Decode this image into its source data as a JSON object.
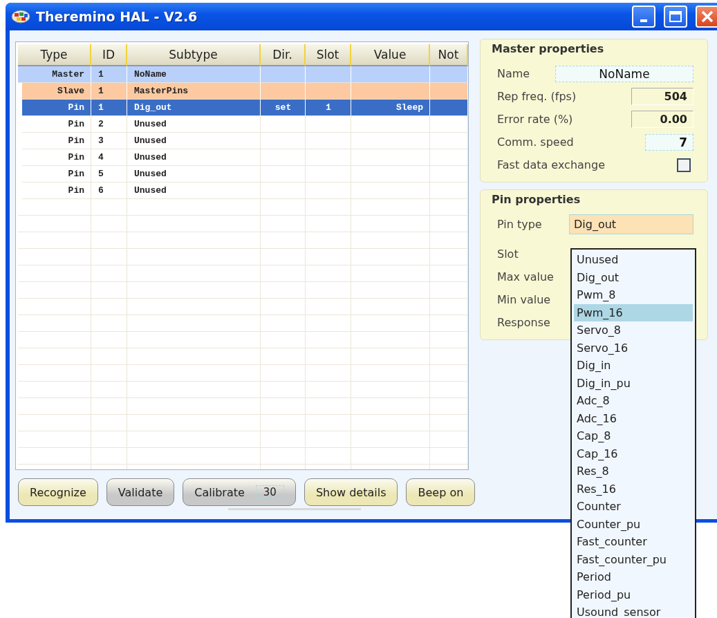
{
  "window": {
    "title": "Theremino HAL - V2.6"
  },
  "table": {
    "columns": [
      "Type",
      "ID",
      "Subtype",
      "Dir.",
      "Slot",
      "Value",
      "Not"
    ],
    "rows": [
      {
        "kind": "master",
        "selected": false,
        "type": "Master",
        "id": "1",
        "subtype": "NoName"
      },
      {
        "kind": "slave",
        "selected": false,
        "type": "Slave",
        "id": "1",
        "subtype": "MasterPins"
      },
      {
        "kind": "pin",
        "selected": true,
        "type": "Pin",
        "id": "1",
        "subtype": "Dig_out",
        "dir": "set",
        "slot": "1",
        "value": "Sleep"
      },
      {
        "kind": "pin",
        "selected": false,
        "type": "Pin",
        "id": "2",
        "subtype": "Unused"
      },
      {
        "kind": "pin",
        "selected": false,
        "type": "Pin",
        "id": "3",
        "subtype": "Unused"
      },
      {
        "kind": "pin",
        "selected": false,
        "type": "Pin",
        "id": "4",
        "subtype": "Unused"
      },
      {
        "kind": "pin",
        "selected": false,
        "type": "Pin",
        "id": "5",
        "subtype": "Unused"
      },
      {
        "kind": "pin",
        "selected": false,
        "type": "Pin",
        "id": "6",
        "subtype": "Unused"
      }
    ]
  },
  "master_properties": {
    "title": "Master properties",
    "fields": [
      {
        "kind": "edit",
        "label": "Name",
        "value": "NoName"
      },
      {
        "kind": "readout",
        "label": "Rep freq. (fps)",
        "value": "504"
      },
      {
        "kind": "readout",
        "label": "Error rate (%)",
        "value": "0.00"
      },
      {
        "kind": "spin",
        "label": "Comm. speed",
        "value": "7"
      },
      {
        "kind": "checkbox",
        "label": "Fast data exchange",
        "checked": false
      }
    ]
  },
  "pin_properties": {
    "title": "Pin properties",
    "pin_type": {
      "label": "Pin type",
      "value": "Dig_out"
    },
    "labels": [
      "Slot",
      "Max value",
      "Min value",
      "Response"
    ]
  },
  "dropdown": {
    "items": [
      {
        "label": "Unused",
        "selected": false
      },
      {
        "label": "Dig_out",
        "selected": false
      },
      {
        "label": "Pwm_8",
        "selected": false
      },
      {
        "label": "Pwm_16",
        "selected": true
      },
      {
        "label": "Servo_8",
        "selected": false
      },
      {
        "label": "Servo_16",
        "selected": false
      },
      {
        "label": "Dig_in",
        "selected": false
      },
      {
        "label": "Dig_in_pu",
        "selected": false
      },
      {
        "label": "Adc_8",
        "selected": false
      },
      {
        "label": "Adc_16",
        "selected": false
      },
      {
        "label": "Cap_8",
        "selected": false
      },
      {
        "label": "Cap_16",
        "selected": false
      },
      {
        "label": "Res_8",
        "selected": false
      },
      {
        "label": "Res_16",
        "selected": false
      },
      {
        "label": "Counter",
        "selected": false
      },
      {
        "label": "Counter_pu",
        "selected": false
      },
      {
        "label": "Fast_counter",
        "selected": false
      },
      {
        "label": "Fast_counter_pu",
        "selected": false
      },
      {
        "label": "Period",
        "selected": false
      },
      {
        "label": "Period_pu",
        "selected": false
      },
      {
        "label": "Usound_sensor",
        "selected": false
      }
    ]
  },
  "buttons": [
    {
      "label": "Recognize",
      "color": "#ece7b4"
    },
    {
      "label": "Validate",
      "color": "#c8c8c8"
    },
    {
      "label": "Calibrate",
      "color": "#c8c8c8",
      "value": "30"
    },
    {
      "label": "Show details",
      "color": "#ece7b4"
    },
    {
      "label": "Beep on",
      "color": "#ece7b4"
    }
  ]
}
